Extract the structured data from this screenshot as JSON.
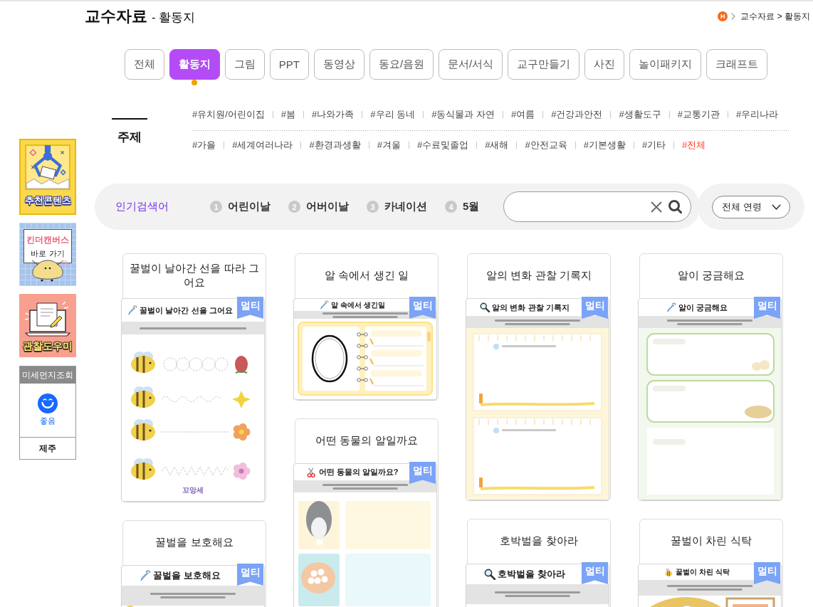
{
  "header": {
    "title": "교수자료",
    "subtitle": "- 활동지",
    "breadcrumb": {
      "home": "H",
      "path": "교수자료 > 활동지"
    }
  },
  "tabs": [
    {
      "label": "전체",
      "selected": false
    },
    {
      "label": "활동지",
      "selected": true
    },
    {
      "label": "그림",
      "selected": false
    },
    {
      "label": "PPT",
      "selected": false
    },
    {
      "label": "동영상",
      "selected": false
    },
    {
      "label": "동요/음원",
      "selected": false
    },
    {
      "label": "문서/서식",
      "selected": false
    },
    {
      "label": "교구만들기",
      "selected": false
    },
    {
      "label": "사진",
      "selected": false
    },
    {
      "label": "놀이패키지",
      "selected": false
    },
    {
      "label": "크래프트",
      "selected": false
    }
  ],
  "topics": {
    "label": "주제",
    "tags": [
      {
        "label": "#유치원/어린이집",
        "selected": false
      },
      {
        "label": "#봄",
        "selected": false
      },
      {
        "label": "#나와가족",
        "selected": false
      },
      {
        "label": "#우리 동네",
        "selected": false
      },
      {
        "label": "#동식물과 자연",
        "selected": false
      },
      {
        "label": "#여름",
        "selected": false
      },
      {
        "label": "#건강과안전",
        "selected": false
      },
      {
        "label": "#생활도구",
        "selected": false
      },
      {
        "label": "#교통기관",
        "selected": false
      },
      {
        "label": "#우리나라",
        "selected": false
      },
      {
        "label": "#가을",
        "selected": false
      },
      {
        "label": "#세계여러나라",
        "selected": false
      },
      {
        "label": "#환경과생활",
        "selected": false
      },
      {
        "label": "#겨울",
        "selected": false
      },
      {
        "label": "#수료및졸업",
        "selected": false
      },
      {
        "label": "#새해",
        "selected": false
      },
      {
        "label": "#안전교육",
        "selected": false
      },
      {
        "label": "#기본생활",
        "selected": false
      },
      {
        "label": "#기타",
        "selected": false
      },
      {
        "label": "#전체",
        "selected": true
      }
    ]
  },
  "popular": {
    "label": "인기검색어",
    "keywords": [
      {
        "rank": "1",
        "label": "어린이날"
      },
      {
        "rank": "2",
        "label": "어버이날"
      },
      {
        "rank": "3",
        "label": "카네이션"
      },
      {
        "rank": "4",
        "label": "5월"
      }
    ]
  },
  "age_filter": {
    "label": "전체 연령"
  },
  "sidebar": {
    "banners": [
      {
        "kind": "claw",
        "title": "추천콘텐츠"
      },
      {
        "kind": "canvas",
        "title": "킨더캔버스",
        "subtitle": "바로 가기"
      },
      {
        "kind": "laptop",
        "title": "관찰도우미"
      }
    ],
    "dust": {
      "title": "미세먼지조회",
      "status": "좋음",
      "region": "제주"
    }
  },
  "card_columns": [
    [
      {
        "title": "꿀벌이 날아간 선을 따라 그어요",
        "preview": {
          "kind": "tracing",
          "title": "꿀벌이 날아간 선을 그어요",
          "badge": "멀티",
          "footer": "꼬망세"
        }
      },
      {
        "title": "꿀벌을 보호해요",
        "preview": {
          "kind": "protect",
          "title": "꿀벌을 보호해요",
          "badge": "멀티"
        }
      }
    ],
    [
      {
        "title": "알 속에서 생긴 일",
        "preview": {
          "kind": "notebook",
          "title": "알 속에서 생긴일",
          "badge": "멀티"
        }
      },
      {
        "title": "어떤 동물의 알일까요",
        "preview": {
          "kind": "animal_eggs",
          "title": "어떤 동물의 알일까요?",
          "badge": "멀티"
        }
      }
    ],
    [
      {
        "title": "알의 변화 관찰 기록지",
        "preview": {
          "kind": "journal",
          "title": "알의 변화 관찰 기록지",
          "badge": "멀티"
        }
      },
      {
        "title": "호박벌을 찾아라",
        "preview": {
          "kind": "find",
          "title": "호박벌을 찾아라",
          "badge": "멀티"
        }
      }
    ],
    [
      {
        "title": "알이 궁금해요",
        "preview": {
          "kind": "question_boxes",
          "title": "알이 궁금해요",
          "badge": "멀티"
        }
      },
      {
        "title": "꿀벌이 차린 식탁",
        "preview": {
          "kind": "menu",
          "title": "꿀벌이 차린 식탁",
          "badge": "멀티"
        }
      }
    ]
  ]
}
